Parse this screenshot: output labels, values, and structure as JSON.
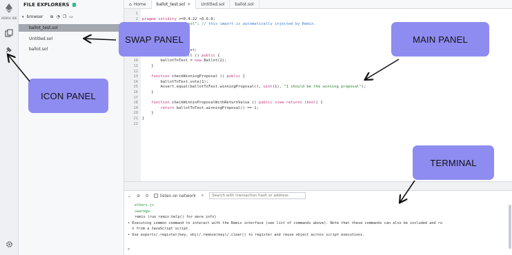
{
  "icon_panel": {
    "logo_text": "REMIX IDE",
    "icons": [
      "ethereum-logo-icon",
      "file-explorer-icon",
      "plugin-icon",
      "settings-icon"
    ]
  },
  "swap_panel": {
    "title": "FILE EXPLORERS",
    "tree_root": "browser",
    "files": [
      "ballot_test.sol",
      "Untitled.sol",
      "ballot.sol"
    ]
  },
  "tabs": {
    "home": "Home",
    "items": [
      "ballot_test.sol",
      "Untitled.sol",
      "ballot.sol"
    ]
  },
  "editor": {
    "lines": [
      {
        "n": "1",
        "text": ""
      },
      {
        "n": "2",
        "text": "pragma solidity >=0.4.22 <0.6.0;"
      },
      {
        "n": "3",
        "text": "import \"remix_tests.sol\"; // this import is automatically injected by Remix."
      },
      {
        "n": "4",
        "text": ""
      },
      {
        "n": "5",
        "text": ""
      },
      {
        "n": "6",
        "text": ""
      },
      {
        "n": "7",
        "text": ""
      },
      {
        "n": "8",
        "text": "    Ballot ballotToTest;"
      },
      {
        "n": "9",
        "text": "    function beforeAll () public {"
      },
      {
        "n": "10",
        "text": "        ballotToTest = new Ballot(2);"
      },
      {
        "n": "11",
        "text": "    }"
      },
      {
        "n": "12",
        "text": ""
      },
      {
        "n": "13",
        "text": "    function checkWinningProposal () public {"
      },
      {
        "n": "14",
        "text": "        ballotToTest.vote(1);"
      },
      {
        "n": "15",
        "text": "        Assert.equal(ballotToTest.winningProposal(), uint(1), \"1 should be the winning proposal\");"
      },
      {
        "n": "16",
        "text": "    }"
      },
      {
        "n": "17",
        "text": ""
      },
      {
        "n": "18",
        "text": "    function checkWinninProposalWithReturnValue () public view returns (bool) {"
      },
      {
        "n": "19",
        "text": "        return ballotToTest.winningProposal() == 1;"
      },
      {
        "n": "20",
        "text": "    }"
      },
      {
        "n": "21",
        "text": "}"
      },
      {
        "n": "22",
        "text": ""
      }
    ]
  },
  "terminal": {
    "listen_label": "listen on network",
    "search_placeholder": "Search with transaction hash or address",
    "lines": [
      {
        "text": "ethers.js",
        "style": "green"
      },
      {
        "text": "swarmgw",
        "style": "green"
      },
      {
        "text": "remix (run remix.help() for more info)",
        "style": ""
      },
      {
        "text": "• Executing common command to interact with the Remix interface (see list of commands above). Note that these commands can also be included and ru",
        "style": ""
      },
      {
        "text": "  n from a JavaScript script.",
        "style": ""
      },
      {
        "text": "• Use exports/.register(key, obj)/.remove(key)/.clear() to register and reuse object across script executions.",
        "style": ""
      }
    ],
    "prompt": ">"
  },
  "callouts": {
    "swap_panel": "SWAP PANEL",
    "main_panel": "MAIN PANEL",
    "icon_panel": "ICON PANEL",
    "terminal": "TERMINAL"
  },
  "colors": {
    "callout_bg": "#8e8cf0",
    "selected_file_bg": "#a2a8ae",
    "keyword": "#c0327a",
    "string": "#2a7d2a",
    "comment": "#3a7bd5"
  }
}
